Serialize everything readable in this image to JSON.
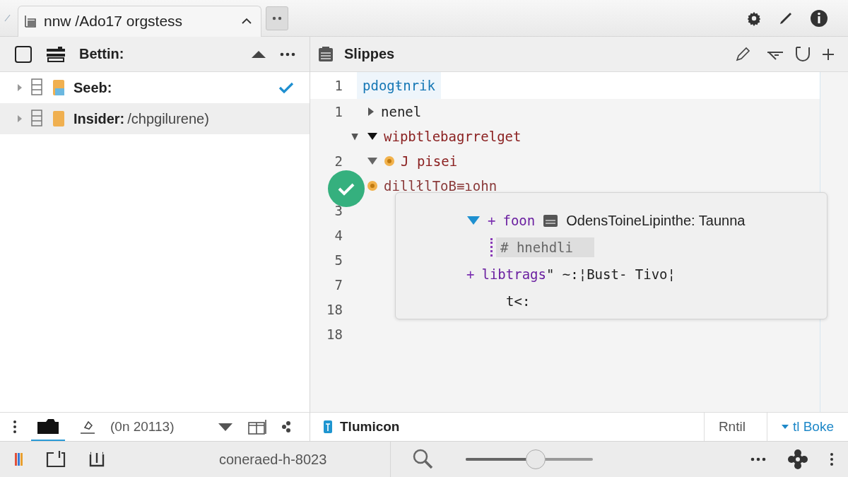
{
  "top_bar": {
    "tab": {
      "title": "nnw /Ado17 orgstess"
    }
  },
  "left_panel": {
    "title": "Bettin:",
    "tree": [
      {
        "label": "Seeb:",
        "checked": true,
        "selected": false
      },
      {
        "label": "Insider:",
        "detail": "/chpgilurene)",
        "checked": false,
        "selected": true
      }
    ],
    "toolbar": {
      "text": "(0n 20113)"
    }
  },
  "editor": {
    "title": "Slippes",
    "lines": [
      {
        "number": "1",
        "kind": "keyword",
        "badge": false,
        "text": "pdogŧnrik"
      },
      {
        "number": "1",
        "kind": "plain",
        "expanded": false,
        "badge": false,
        "text": "nenel"
      },
      {
        "kind": "string",
        "expanded": true,
        "gutter_marker": "▼",
        "badge": false,
        "text": "wipbtlebagrrelget"
      },
      {
        "number": "2",
        "kind": "string",
        "expanded": true,
        "badge": true,
        "text": "J pisei"
      },
      {
        "kind": "mixed",
        "badge": true,
        "text": "dillłlToB≡ɿohn"
      }
    ],
    "more_line_numbers": [
      "3",
      "4",
      "5",
      "7",
      "18",
      "18"
    ],
    "popup": {
      "lines": [
        {
          "kind": "head",
          "prefix": "+",
          "text": "foon",
          "detail": "OdensToineLipinthe: Taunna"
        },
        {
          "kind": "comment",
          "text": "# hnehdli"
        },
        {
          "kind": "entry",
          "prefix": "+",
          "text": "libtrags",
          "detail": "\" ~:¦Bust- Tivo¦"
        },
        {
          "kind": "plain",
          "text": "t<:"
        }
      ]
    }
  },
  "bottom_bar": {
    "left_tab": "Tlumicon",
    "tabs": [
      {
        "label": "Rntil",
        "selected": false
      },
      {
        "label": "tl Boke",
        "selected": true
      }
    ]
  },
  "status_bar": {
    "text": "coneraed-h-8023",
    "zoom": {
      "level": 0.55
    }
  }
}
